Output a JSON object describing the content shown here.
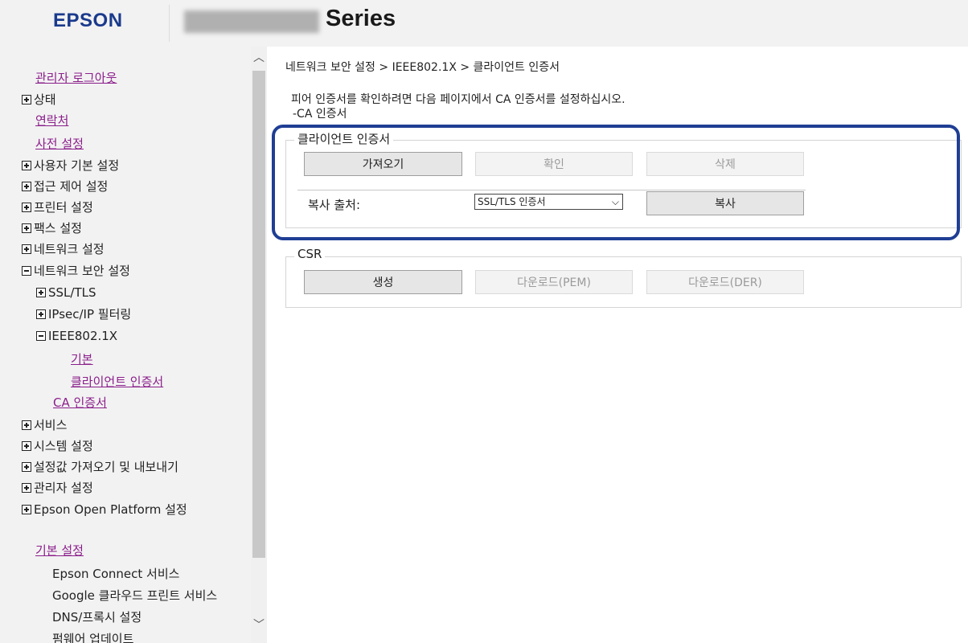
{
  "header": {
    "logo": "EPSON",
    "series": "Series"
  },
  "sidebar": {
    "items": [
      {
        "label": "관리자 로그아웃",
        "type": "link"
      },
      {
        "label": "상태",
        "type": "plus"
      },
      {
        "label": "연락처",
        "type": "link"
      },
      {
        "label": "사전 설정",
        "type": "link"
      },
      {
        "label": "사용자 기본 설정",
        "type": "plus"
      },
      {
        "label": "접근 제어 설정",
        "type": "plus"
      },
      {
        "label": "프린터 설정",
        "type": "plus"
      },
      {
        "label": "팩스 설정",
        "type": "plus"
      },
      {
        "label": "네트워크 설정",
        "type": "plus"
      },
      {
        "label": "네트워크 보안 설정",
        "type": "minus"
      },
      {
        "label": "SSL/TLS",
        "type": "plus"
      },
      {
        "label": "IPsec/IP 필터링",
        "type": "plus"
      },
      {
        "label": "IEEE802.1X",
        "type": "minus"
      },
      {
        "label": "기본",
        "type": "link"
      },
      {
        "label": "클라이언트 인증서",
        "type": "link"
      },
      {
        "label": "CA 인증서",
        "type": "link"
      },
      {
        "label": "서비스",
        "type": "plus"
      },
      {
        "label": "시스템 설정",
        "type": "plus"
      },
      {
        "label": "설정값 가져오기 및 내보내기",
        "type": "plus"
      },
      {
        "label": "관리자 설정",
        "type": "plus"
      },
      {
        "label": "Epson Open Platform 설정",
        "type": "plus"
      },
      {
        "label": "기본 설정",
        "type": "link"
      },
      {
        "label": "Epson Connect 서비스",
        "type": "text"
      },
      {
        "label": "Google 클라우드 프린트 서비스",
        "type": "text"
      },
      {
        "label": "DNS/프록시 설정",
        "type": "text"
      },
      {
        "label": "펌웨어 업데이트",
        "type": "text"
      }
    ]
  },
  "main": {
    "breadcrumb": "네트워크 보안 설정 > IEEE802.1X > 클라이언트 인증서",
    "description_line1": "피어 인증서를 확인하려면 다음 페이지에서 CA 인증서를 설정하십시오.",
    "description_line2": "-CA 인증서",
    "client_cert": {
      "legend": "클라이언트 인증서",
      "import_label": "가져오기",
      "confirm_label": "확인",
      "delete_label": "삭제",
      "copy_from_label": "복사 출처:",
      "copy_from_value": "SSL/TLS 인증서",
      "copy_label": "복사"
    },
    "csr": {
      "legend": "CSR",
      "generate_label": "생성",
      "download_pem_label": "다운로드(PEM)",
      "download_der_label": "다운로드(DER)"
    }
  },
  "colors": {
    "brand": "#1a3a8c",
    "highlight": "#1f3e94",
    "link": "#8b1f8b"
  }
}
